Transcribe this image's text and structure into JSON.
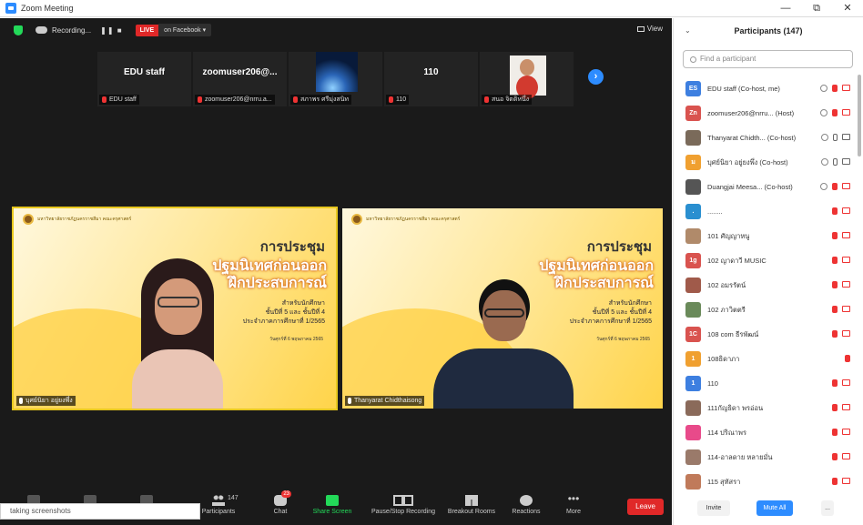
{
  "window": {
    "title": "Zoom Meeting",
    "controls": [
      "—",
      "⧉",
      "✕"
    ]
  },
  "topbar": {
    "recording": "Recording...",
    "rec_controls": "❚❚ ■",
    "live": "LIVE",
    "live_target": "on Facebook ▾",
    "view": "View"
  },
  "thumbnails": [
    {
      "name": "EDU staff",
      "label": "EDU staff"
    },
    {
      "name": "zoomuser206@...",
      "label": "zoomuser206@nrru.a..."
    },
    {
      "name": "",
      "label": "สภาพร ศรีมุ่งสนิท"
    },
    {
      "name": "110",
      "label": "110"
    },
    {
      "name": "",
      "label": "สนอ จิตติหนึ่ง"
    }
  ],
  "videos": [
    {
      "label": "บุศย์นิยา อยู่ยงพึ่ง",
      "slide": {
        "header": "มหาวิทยาลัยราชภัฏนครราชสีมา คณะครุศาสตร์",
        "title": "การประชุม",
        "subtitle_1": "ปฐมนิเทศก่อนออก",
        "subtitle_2": "ฝึกประสบการณ์",
        "detail_1": "สำหรับนักศึกษา",
        "detail_2": "ชั้นปีที่ 5 และ ชั้นปีที่ 4",
        "detail_3": "ประจำภาคการศึกษาที่ 1/2565",
        "date": "วันศุกร์ที่ 6 พฤษภาคม 2565"
      }
    },
    {
      "label": "Thanyarat Chidthaisong",
      "slide": {
        "header": "มหาวิทยาลัยราชภัฏนครราชสีมา คณะครุศาสตร์",
        "title": "การประชุม",
        "subtitle_1": "ปฐมนิเทศก่อนออก",
        "subtitle_2": "ฝึกประสบการณ์",
        "detail_1": "สำหรับนักศึกษา",
        "detail_2": "ชั้นปีที่ 5 และ ชั้นปีที่ 4",
        "detail_3": "ประจำภาคการศึกษาที่ 1/2565",
        "date": "วันศุกร์ที่ 6 พฤษภาคม 2565"
      }
    }
  ],
  "toolbar": {
    "participants_count": "147",
    "participants": "Participants",
    "chat": "Chat",
    "chat_badge": "23",
    "share": "Share Screen",
    "pause_rec": "Pause/Stop Recording",
    "breakout": "Breakout Rooms",
    "reactions": "Reactions",
    "more": "More",
    "leave": "Leave"
  },
  "status_strip": "taking screenshots",
  "panel": {
    "title": "Participants (147)",
    "search_placeholder": "Find a participant",
    "participants": [
      {
        "initials": "ES",
        "color": "#3d7fe0",
        "name": "EDU staff (Co-host, me)"
      },
      {
        "initials": "Zn",
        "color": "#d9534f",
        "name": "zoomuser206@nrru... (Host)"
      },
      {
        "initials": "",
        "color": "#7a6a5a",
        "name": "Thanyarat Chidth... (Co-host)"
      },
      {
        "initials": "ม",
        "color": "#f0a030",
        "name": "บุศย์นิยา อยู่ยงพึ่ง (Co-host)"
      },
      {
        "initials": "",
        "color": "#555555",
        "name": "Duangjai Meesa... (Co-host)"
      },
      {
        "initials": ".",
        "color": "#2a8fd0",
        "name": "........"
      },
      {
        "initials": "",
        "color": "#b08a6a",
        "name": "101 ศัญญาหนู"
      },
      {
        "initials": "1g",
        "color": "#d9534f",
        "name": "102 ญาดาวี MUSIC"
      },
      {
        "initials": "",
        "color": "#a05a4a",
        "name": "102 อมรรัตน์"
      },
      {
        "initials": "",
        "color": "#6a8a5a",
        "name": "102 ภาวิตตรี"
      },
      {
        "initials": "1C",
        "color": "#d9534f",
        "name": "108 com ธีรพัฒน์"
      },
      {
        "initials": "1",
        "color": "#f0a030",
        "name": "108ธิดาภา"
      },
      {
        "initials": "1",
        "color": "#3d7fe0",
        "name": "110"
      },
      {
        "initials": "",
        "color": "#8a6a5a",
        "name": "111กัญธิดา พรอ่อน"
      },
      {
        "initials": "",
        "color": "#e84a8a",
        "name": "114 ปริณาพร"
      },
      {
        "initials": "",
        "color": "#9a7a6a",
        "name": "114-อาลดาย หลายมั่น"
      },
      {
        "initials": "",
        "color": "#c07a5a",
        "name": "115 สุทัสรา"
      }
    ],
    "invite": "Invite",
    "mute_all": "Mute All",
    "more": "..."
  }
}
